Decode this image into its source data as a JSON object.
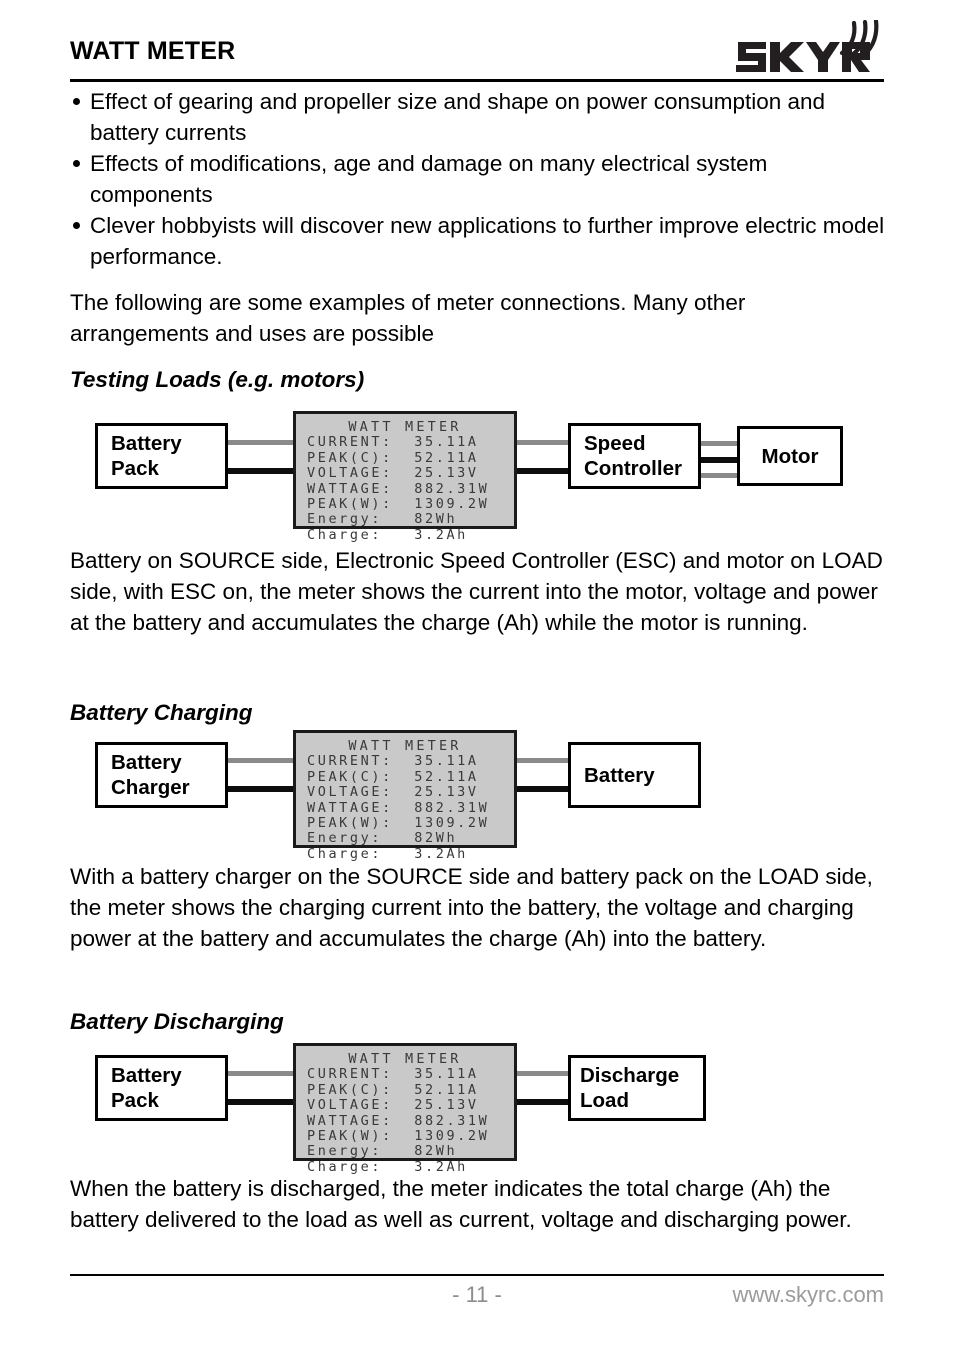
{
  "header": {
    "title": "WATT METER",
    "logo_text": "SKYRC",
    "logo_icon": "signal-waves-icon"
  },
  "bullets": [
    "Effect of gearing and propeller size and shape on power consumption and battery currents",
    "Effects of modifications, age and damage on many electrical system components",
    "Clever hobbyists will discover new applications to further improve electric model performance."
  ],
  "intro_paragraph": "The following are some examples of meter connections. Many other arrangements and uses are possible",
  "lcd": {
    "title": "WATT METER",
    "rows": [
      {
        "label": "CURRENT:",
        "value": "35.11A"
      },
      {
        "label": "PEAK(C):",
        "value": "52.11A"
      },
      {
        "label": "VOLTAGE:",
        "value": "25.13V"
      },
      {
        "label": "WATTAGE:",
        "value": "882.31W"
      },
      {
        "label": "PEAK(W):",
        "value": "1309.2W"
      },
      {
        "label": "Energy:",
        "value": "82Wh"
      },
      {
        "label": "Charge:",
        "value": "3.2Ah"
      }
    ],
    "line_0": "WATT METER",
    "line_1": "CURRENT:  35.11A",
    "line_2": "PEAK(C):  52.11A",
    "line_3": "VOLTAGE:  25.13V",
    "line_4": "WATTAGE:  882.31W",
    "line_5": "PEAK(W):  1309.2W",
    "line_6": "Energy:   82Wh",
    "line_7": "Charge:   3.2Ah"
  },
  "sections": [
    {
      "heading": "Testing Loads (e.g. motors)",
      "nodes": {
        "source_line1": "Battery",
        "source_line2": "Pack",
        "load_line1": "Speed",
        "load_line2": "Controller",
        "extra_line1": "Motor"
      },
      "paragraph": "Battery on SOURCE side, Electronic Speed Controller (ESC) and motor on LOAD side, with ESC on, the meter shows the current into the motor, voltage and power at the battery and accumulates the charge (Ah) while the motor is running."
    },
    {
      "heading": "Battery Charging",
      "nodes": {
        "source_line1": "Battery",
        "source_line2": "Charger",
        "load_line1": "Battery",
        "load_line2": ""
      },
      "paragraph": "With a battery charger on the SOURCE side and battery pack on the LOAD side, the meter shows the charging current into the battery, the voltage and charging power at the battery and accumulates the charge (Ah) into the battery."
    },
    {
      "heading": "Battery Discharging",
      "nodes": {
        "source_line1": "Battery",
        "source_line2": "Pack",
        "load_line1": "Discharge",
        "load_line2": "Load"
      },
      "paragraph": "When the battery is discharged, the meter indicates the total charge (Ah) the battery delivered to the load as well as current, voltage and discharging power."
    }
  ],
  "footer": {
    "page_number": "- 11 -",
    "url": "www.skyrc.com"
  },
  "colors": {
    "lcd_background": "#c9c9c9",
    "lcd_text": "#3a3a3a",
    "wire_gray": "#8a8a8a",
    "wire_black": "#0d0d0d",
    "footer_text": "#9b9b9b"
  }
}
